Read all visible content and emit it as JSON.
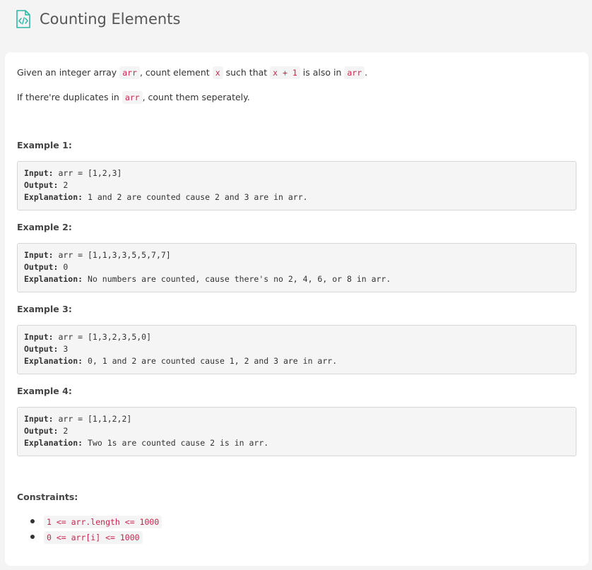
{
  "title": "Counting Elements",
  "description": {
    "p1_pre": "Given an integer array ",
    "p1_code1": "arr",
    "p1_mid1": ", count element ",
    "p1_code2": "x",
    "p1_mid2": " such that ",
    "p1_code3": "x + 1",
    "p1_mid3": " is also in ",
    "p1_code4": "arr",
    "p1_end": ".",
    "p2_pre": "If there're duplicates in ",
    "p2_code": "arr",
    "p2_end": ", count them seperately."
  },
  "examples": [
    {
      "heading": "Example 1:",
      "input_label": "Input:",
      "input": " arr = [1,2,3]",
      "output_label": "Output:",
      "output": " 2",
      "explanation_label": "Explanation:",
      "explanation": " 1 and 2 are counted cause 2 and 3 are in arr."
    },
    {
      "heading": "Example 2:",
      "input_label": "Input:",
      "input": " arr = [1,1,3,3,5,5,7,7]",
      "output_label": "Output:",
      "output": " 0",
      "explanation_label": "Explanation:",
      "explanation": " No numbers are counted, cause there's no 2, 4, 6, or 8 in arr."
    },
    {
      "heading": "Example 3:",
      "input_label": "Input:",
      "input": " arr = [1,3,2,3,5,0]",
      "output_label": "Output:",
      "output": " 3",
      "explanation_label": "Explanation:",
      "explanation": " 0, 1 and 2 are counted cause 1, 2 and 3 are in arr."
    },
    {
      "heading": "Example 4:",
      "input_label": "Input:",
      "input": " arr = [1,1,2,2]",
      "output_label": "Output:",
      "output": " 2",
      "explanation_label": "Explanation:",
      "explanation": " Two 1s are counted cause 2 is in arr."
    }
  ],
  "constraints_heading": "Constraints:",
  "constraints": [
    "1 <= arr.length <= 1000",
    "0 <= arr[i] <= 1000"
  ],
  "colors": {
    "accent_icon": "#2db7a4",
    "inline_code": "#c7254e"
  },
  "icons": {
    "title_icon": "code-file-icon"
  }
}
